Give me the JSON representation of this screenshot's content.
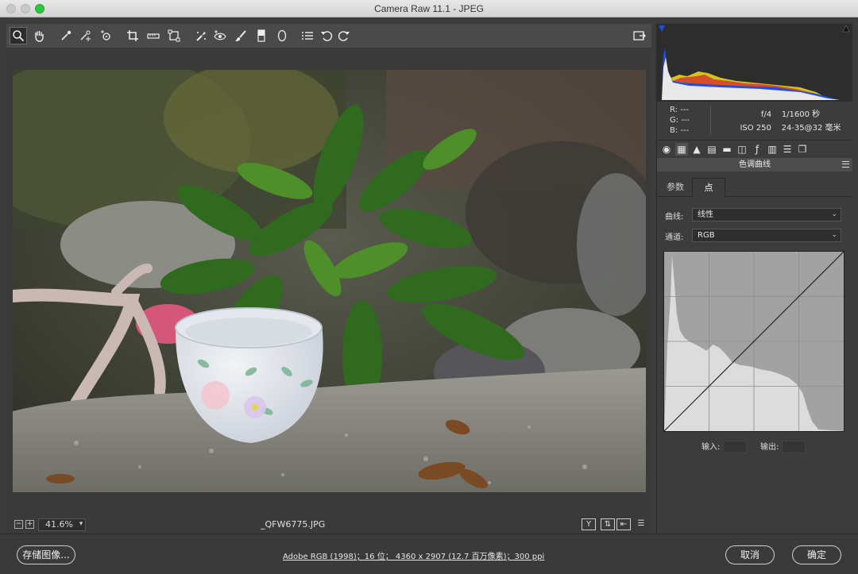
{
  "window": {
    "title": "Camera Raw 11.1 -  JPEG"
  },
  "toolbar": {
    "tools": [
      "zoom-icon",
      "hand-icon",
      "white-balance-icon",
      "color-sampler-icon",
      "targeted-adjustment-icon",
      "crop-icon",
      "straighten-icon",
      "transform-icon",
      "spot-removal-icon",
      "red-eye-icon",
      "adjustment-brush-icon",
      "graduated-filter-icon",
      "radial-filter-icon",
      "preferences-icon",
      "rotate-left-icon",
      "rotate-right-icon"
    ],
    "toggle_fullscreen": "fullscreen-icon"
  },
  "status": {
    "zoom_minus": "−",
    "zoom_plus": "+",
    "zoom_value": "41.6%",
    "filename": "_QFW6775.JPG"
  },
  "readout": {
    "r_label": "R:",
    "r_value": "---",
    "g_label": "G:",
    "g_value": "---",
    "b_label": "B:",
    "b_value": "---",
    "aperture": "f/4",
    "shutter": "1/1600 秒",
    "iso": "ISO 250",
    "lens": "24-35@32 毫米"
  },
  "panel": {
    "section_title": "色调曲线",
    "tabs": [
      "参数",
      "点"
    ],
    "curve_label": "曲线:",
    "curve_value": "线性",
    "channel_label": "通道:",
    "channel_value": "RGB",
    "input_label": "输入:",
    "output_label": "输出:"
  },
  "footer": {
    "save_label": "存储图像...",
    "info_text": "Adobe RGB (1998)；16 位； 4360 x 2907 (12.7 百万像素)；300 ppi",
    "cancel_label": "取消",
    "ok_label": "确定"
  },
  "colors": {
    "accent_blue": "#1d4fe0",
    "window_bg": "#3c3c3c"
  }
}
